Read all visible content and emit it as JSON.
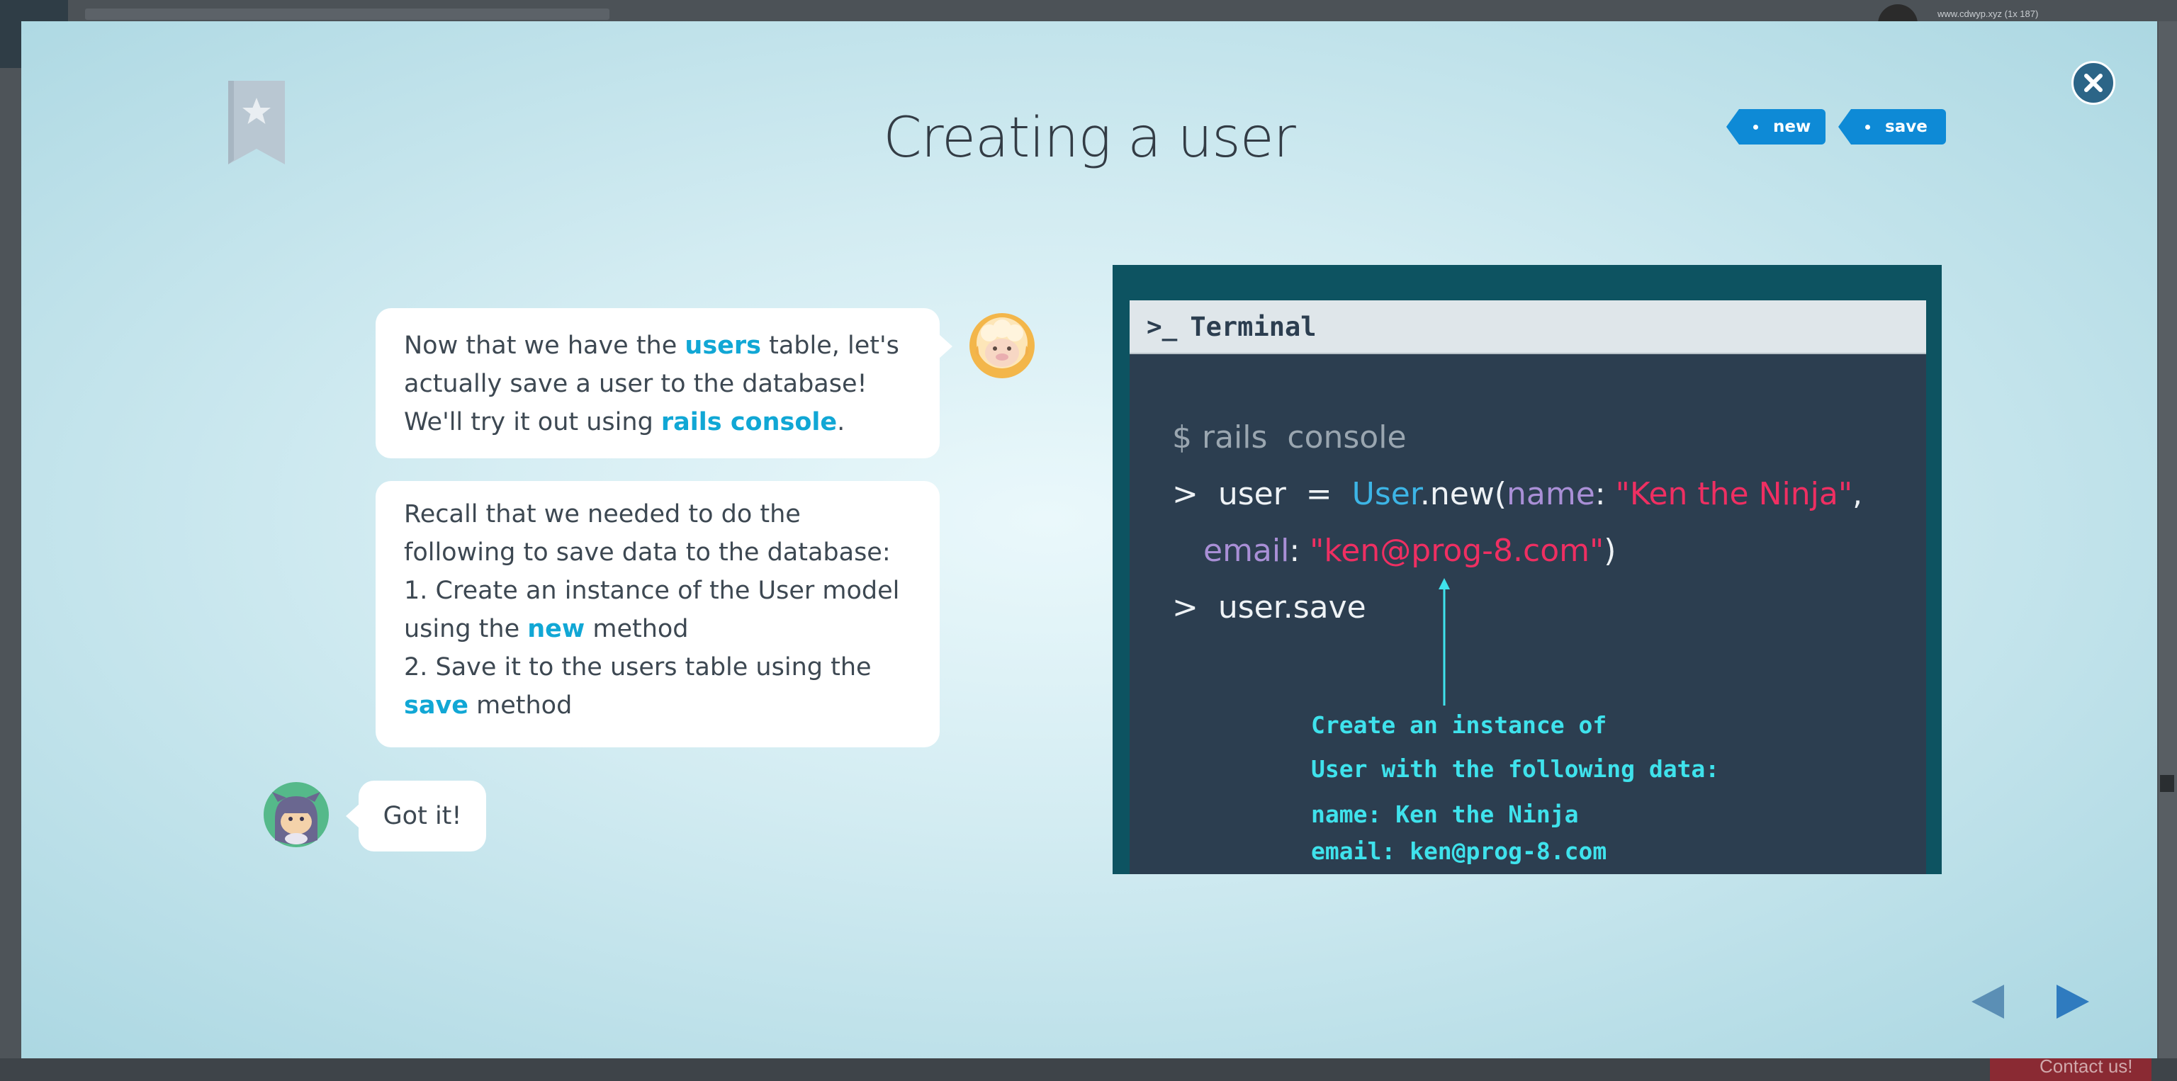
{
  "background_app": {
    "url_text": "www.cdwyp.xyz (1x 187)",
    "contact_label": "Contact us!"
  },
  "lesson": {
    "title": "Creating a user",
    "tags": [
      "new",
      "save"
    ]
  },
  "chat": {
    "bubble1": {
      "part1": "Now that we have the ",
      "hl1": "users",
      "part2": " table, let's actually save a user to the database! We'll try it out using ",
      "hl2": "rails console",
      "part3": "."
    },
    "bubble2": {
      "intro": "Recall that we needed to do the following to save data to the database:",
      "step1_pre": "1. Create an instance of the User model using the ",
      "step1_hl": "new",
      "step1_post": " method",
      "step2_pre": "2. Save it to the users table using the ",
      "step2_hl": "save",
      "step2_post": " method"
    },
    "reply": "Got it!"
  },
  "terminal": {
    "title": "Terminal",
    "line1": "$ rails  console",
    "line2_prompt": ">  user  =  ",
    "line2_class": "User",
    "line2_method": ".new(",
    "line2_key": "name",
    "line2_colon": ": ",
    "line2_value": "\"Ken the Ninja\"",
    "line2_comma": ",",
    "line3_key": "email",
    "line3_colon": ": ",
    "line3_value": "\"ken@prog-8.com\"",
    "line3_close": ")",
    "line4": ">  user.save",
    "note_line1": "Create an instance of",
    "note_line2": "User with the following data:",
    "note_line3": "name: Ken the Ninja",
    "note_line4": "email: ken@prog-8.com"
  },
  "icons": {
    "close": "close-icon",
    "bookmark": "bookmark-star-icon",
    "prev": "triangle-left-icon",
    "next": "triangle-right-icon",
    "sheep": "sheep-avatar",
    "ninja": "ninja-avatar"
  },
  "colors": {
    "accent": "#0e8ad6",
    "highlight": "#11a7d5",
    "close_button": "#2c6587",
    "terminal_frame": "#0d5361",
    "terminal_body": "#2c3e50",
    "note_text": "#3fe2ec",
    "string": "#ef2f62",
    "keyword": "#a98fd6",
    "class": "#3db5e6"
  }
}
